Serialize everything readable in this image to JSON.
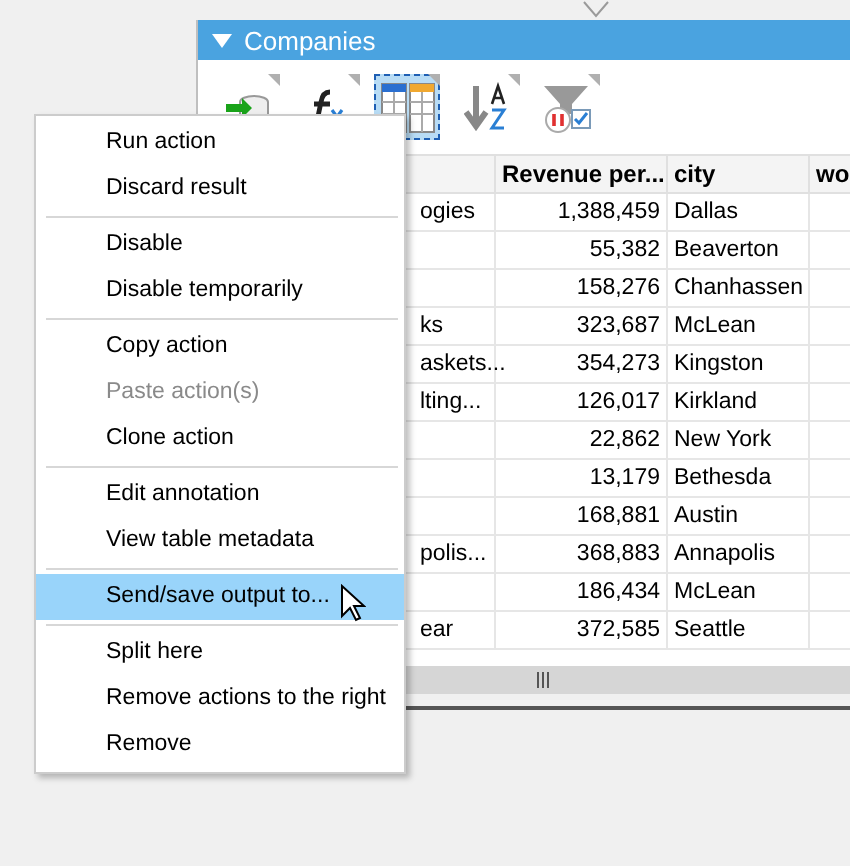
{
  "panel": {
    "title": "Companies",
    "expanded": true
  },
  "toolbar": [
    {
      "kind": "import",
      "selected": false
    },
    {
      "kind": "formula",
      "selected": false
    },
    {
      "kind": "layout",
      "selected": true
    },
    {
      "kind": "sort",
      "selected": false
    },
    {
      "kind": "filter",
      "selected": false
    }
  ],
  "table": {
    "columns": [
      {},
      {
        "label": "Revenue per..."
      },
      {
        "label": "city"
      },
      {
        "label": "wo"
      }
    ],
    "rows": [
      [
        "ogies",
        "1,388,459",
        "Dallas",
        ""
      ],
      [
        "",
        "55,382",
        "Beaverton",
        ""
      ],
      [
        "",
        "158,276",
        "Chanhassen",
        ""
      ],
      [
        "ks",
        "323,687",
        "McLean",
        ""
      ],
      [
        "askets...",
        "354,273",
        "Kingston",
        ""
      ],
      [
        "lting...",
        "126,017",
        "Kirkland",
        ""
      ],
      [
        "",
        "22,862",
        "New York",
        ""
      ],
      [
        "",
        "13,179",
        "Bethesda",
        ""
      ],
      [
        "",
        "168,881",
        "Austin",
        ""
      ],
      [
        "polis...",
        "368,883",
        "Annapolis",
        ""
      ],
      [
        "",
        "186,434",
        "McLean",
        ""
      ],
      [
        "ear",
        "372,585",
        "Seattle",
        ""
      ]
    ]
  },
  "context_menu": [
    {
      "kind": "item",
      "label": "Run action",
      "disabled": false,
      "selected": false
    },
    {
      "kind": "item",
      "label": "Discard result",
      "disabled": false,
      "selected": false
    },
    {
      "kind": "separator"
    },
    {
      "kind": "item",
      "label": "Disable",
      "disabled": false,
      "selected": false
    },
    {
      "kind": "item",
      "label": "Disable temporarily",
      "disabled": false,
      "selected": false
    },
    {
      "kind": "separator"
    },
    {
      "kind": "item",
      "label": "Copy action",
      "disabled": false,
      "selected": false
    },
    {
      "kind": "item",
      "label": "Paste action(s)",
      "disabled": true,
      "selected": false
    },
    {
      "kind": "item",
      "label": "Clone action",
      "disabled": false,
      "selected": false
    },
    {
      "kind": "separator"
    },
    {
      "kind": "item",
      "label": "Edit annotation",
      "disabled": false,
      "selected": false
    },
    {
      "kind": "item",
      "label": "View table metadata",
      "disabled": false,
      "selected": false
    },
    {
      "kind": "separator"
    },
    {
      "kind": "item",
      "label": "Send/save output to...",
      "disabled": false,
      "selected": true
    },
    {
      "kind": "separator"
    },
    {
      "kind": "item",
      "label": "Split here",
      "disabled": false,
      "selected": false
    },
    {
      "kind": "item",
      "label": "Remove actions to the right",
      "disabled": false,
      "selected": false
    },
    {
      "kind": "item",
      "label": "Remove",
      "disabled": false,
      "selected": false
    }
  ]
}
